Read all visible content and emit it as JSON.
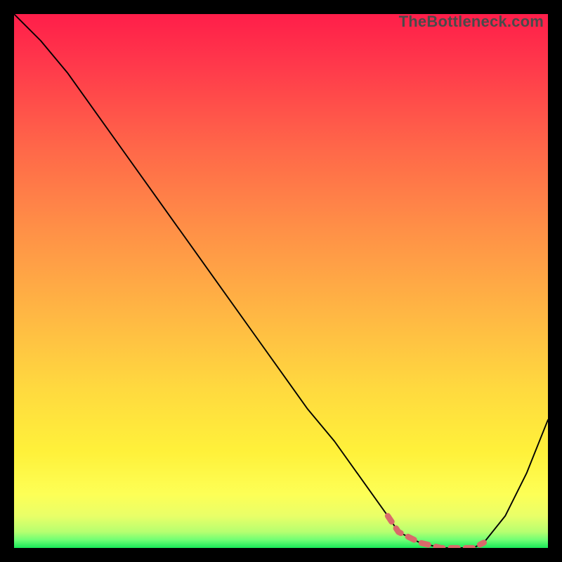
{
  "watermark": "TheBottleneck.com",
  "chart_data": {
    "type": "line",
    "title": "",
    "xlabel": "",
    "ylabel": "",
    "xlim": [
      0,
      100
    ],
    "ylim": [
      0,
      100
    ],
    "grid": false,
    "legend": false,
    "series": [
      {
        "name": "main-curve",
        "color": "#000000",
        "x": [
          0,
          5,
          10,
          15,
          20,
          25,
          30,
          35,
          40,
          45,
          50,
          55,
          60,
          65,
          70,
          72,
          76,
          80,
          84,
          86,
          88,
          92,
          96,
          100
        ],
        "y": [
          100,
          95,
          89,
          82,
          75,
          68,
          61,
          54,
          47,
          40,
          33,
          26,
          20,
          13,
          6,
          3,
          1,
          0,
          0,
          0,
          1,
          6,
          14,
          24
        ]
      },
      {
        "name": "highlight-segment",
        "color": "#d96a6a",
        "x": [
          70,
          72,
          76,
          80,
          84,
          86,
          88
        ],
        "y": [
          6,
          3,
          1,
          0,
          0,
          0,
          1
        ]
      }
    ],
    "background_gradient_stops": [
      {
        "offset": 0.0,
        "color": "#ff1e4a"
      },
      {
        "offset": 0.1,
        "color": "#ff3a4b"
      },
      {
        "offset": 0.25,
        "color": "#ff6749"
      },
      {
        "offset": 0.4,
        "color": "#ff8f47"
      },
      {
        "offset": 0.55,
        "color": "#ffb444"
      },
      {
        "offset": 0.7,
        "color": "#ffd93f"
      },
      {
        "offset": 0.82,
        "color": "#fff13a"
      },
      {
        "offset": 0.9,
        "color": "#fdff56"
      },
      {
        "offset": 0.94,
        "color": "#e9ff68"
      },
      {
        "offset": 0.97,
        "color": "#b6ff70"
      },
      {
        "offset": 0.985,
        "color": "#6fff74"
      },
      {
        "offset": 1.0,
        "color": "#18e858"
      }
    ]
  }
}
